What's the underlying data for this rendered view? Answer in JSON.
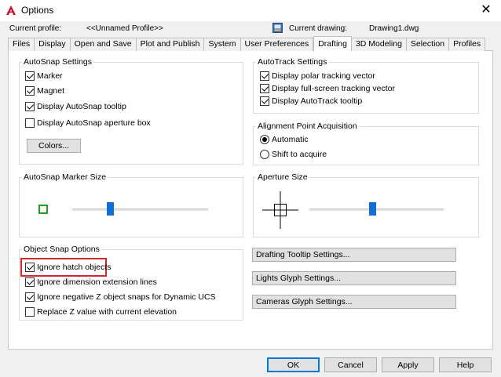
{
  "window": {
    "title": "Options",
    "close_glyph": "✕"
  },
  "profile": {
    "current_profile_label": "Current profile:",
    "current_profile_value": "<<Unnamed Profile>>",
    "current_drawing_label": "Current drawing:",
    "current_drawing_value": "Drawing1.dwg"
  },
  "tabs": [
    {
      "label": "Files"
    },
    {
      "label": "Display"
    },
    {
      "label": "Open and Save"
    },
    {
      "label": "Plot and Publish"
    },
    {
      "label": "System"
    },
    {
      "label": "User Preferences"
    },
    {
      "label": "Drafting",
      "active": true
    },
    {
      "label": "3D Modeling"
    },
    {
      "label": "Selection"
    },
    {
      "label": "Profiles"
    }
  ],
  "autosnap": {
    "title": "AutoSnap Settings",
    "marker": {
      "label": "Marker",
      "checked": true
    },
    "magnet": {
      "label": "Magnet",
      "checked": true
    },
    "tooltip": {
      "label": "Display AutoSnap tooltip",
      "checked": true
    },
    "aperture_box": {
      "label": "Display AutoSnap aperture box",
      "checked": false
    },
    "colors_button": "Colors..."
  },
  "autotrack": {
    "title": "AutoTrack Settings",
    "polar": {
      "label": "Display polar tracking vector",
      "checked": true
    },
    "fullscreen": {
      "label": "Display full-screen tracking vector",
      "checked": true
    },
    "tooltip": {
      "label": "Display AutoTrack tooltip",
      "checked": true
    }
  },
  "alignment": {
    "title": "Alignment Point Acquisition",
    "automatic": {
      "label": "Automatic",
      "selected": true
    },
    "shift": {
      "label": "Shift to acquire",
      "selected": false
    }
  },
  "marker_size": {
    "title": "AutoSnap Marker Size",
    "level": 0.28
  },
  "aperture_size": {
    "title": "Aperture Size",
    "level": 0.47
  },
  "object_snap": {
    "title": "Object Snap Options",
    "ignore_hatch": {
      "label": "Ignore hatch objects",
      "checked": true
    },
    "ignore_dim": {
      "label": "Ignore dimension extension lines",
      "checked": true
    },
    "ignore_negz": {
      "label": "Ignore negative Z object snaps for Dynamic UCS",
      "checked": true
    },
    "replace_z": {
      "label": "Replace Z value with current elevation",
      "checked": false
    }
  },
  "side_buttons": {
    "drafting_tooltip": "Drafting Tooltip Settings...",
    "lights_glyph": "Lights Glyph Settings...",
    "cameras_glyph": "Cameras Glyph Settings..."
  },
  "footer": {
    "ok": "OK",
    "cancel": "Cancel",
    "apply": "Apply",
    "help": "Help"
  },
  "colors": {
    "accent": "#0f6fd6",
    "highlight": "#d62828",
    "marker": "#1ea01e",
    "brand": "#c8102e"
  },
  "icons": {
    "app": "autocad-logo-icon",
    "drawing": "drawing-file-icon"
  }
}
